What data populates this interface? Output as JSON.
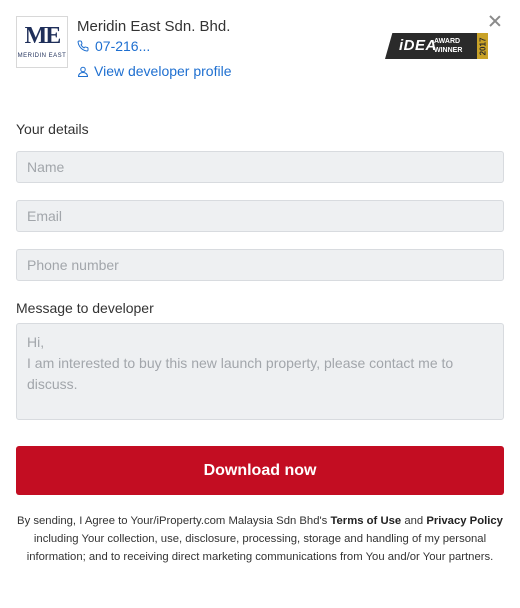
{
  "developer": {
    "logo_text": "ME",
    "logo_subtext": "MERIDIN EAST",
    "name": "Meridin East Sdn. Bhd.",
    "phone": "07-216...",
    "profile_link": "View developer profile"
  },
  "badge": {
    "idea": "iDEA",
    "award_line1": "AWARD",
    "award_line2": "WINNER",
    "year": "2017"
  },
  "form": {
    "details_title": "Your details",
    "name_placeholder": "Name",
    "email_placeholder": "Email",
    "phone_placeholder": "Phone number",
    "message_title": "Message to developer",
    "message_placeholder": "Hi,\nI am interested to buy this new launch property, please contact me to discuss.",
    "submit_label": "Download now"
  },
  "legal": {
    "prefix": "By sending, I Agree to Your/iProperty.com Malaysia Sdn Bhd's ",
    "terms": "Terms of Use",
    "and": " and ",
    "privacy": "Privacy Policy",
    "suffix": " including Your collection, use, disclosure, processing, storage and handling of my personal information; and to receiving direct marketing communications from You and/or Your partners."
  },
  "colors": {
    "accent_blue": "#1e6fd0",
    "button_red": "#c30d22",
    "input_bg": "#eef0f2"
  }
}
